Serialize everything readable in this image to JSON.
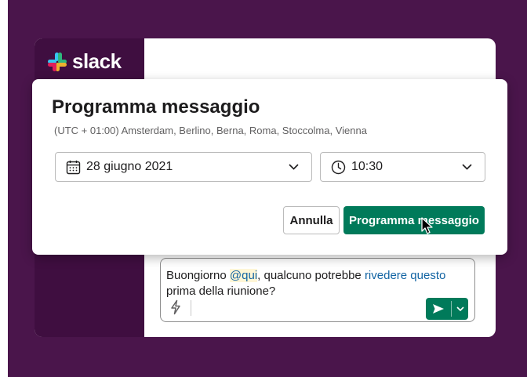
{
  "brand": {
    "name": "slack"
  },
  "modal": {
    "title": "Programma messaggio",
    "timezone": "(UTC + 01:00) Amsterdam, Berlino, Berna, Roma, Stoccolma, Vienna",
    "date_value": "28 giugno 2021",
    "time_value": "10:30",
    "cancel_label": "Annulla",
    "confirm_label": "Programma messaggio"
  },
  "composer": {
    "text_before": "Buongiorno ",
    "mention": "@qui",
    "text_middle": ", qualcuno potrebbe ",
    "link_text": "rivedere questo",
    "text_after": " prima della riunione?"
  },
  "colors": {
    "aubergine": "#4a154b",
    "sidebar": "#3f0e40",
    "primary": "#007a5a",
    "link": "#1264a3"
  },
  "icons": {
    "calendar": "calendar-icon",
    "clock": "clock-icon",
    "chevron": "chevron-down-icon",
    "shortcut": "lightning-icon",
    "send": "send-icon"
  }
}
